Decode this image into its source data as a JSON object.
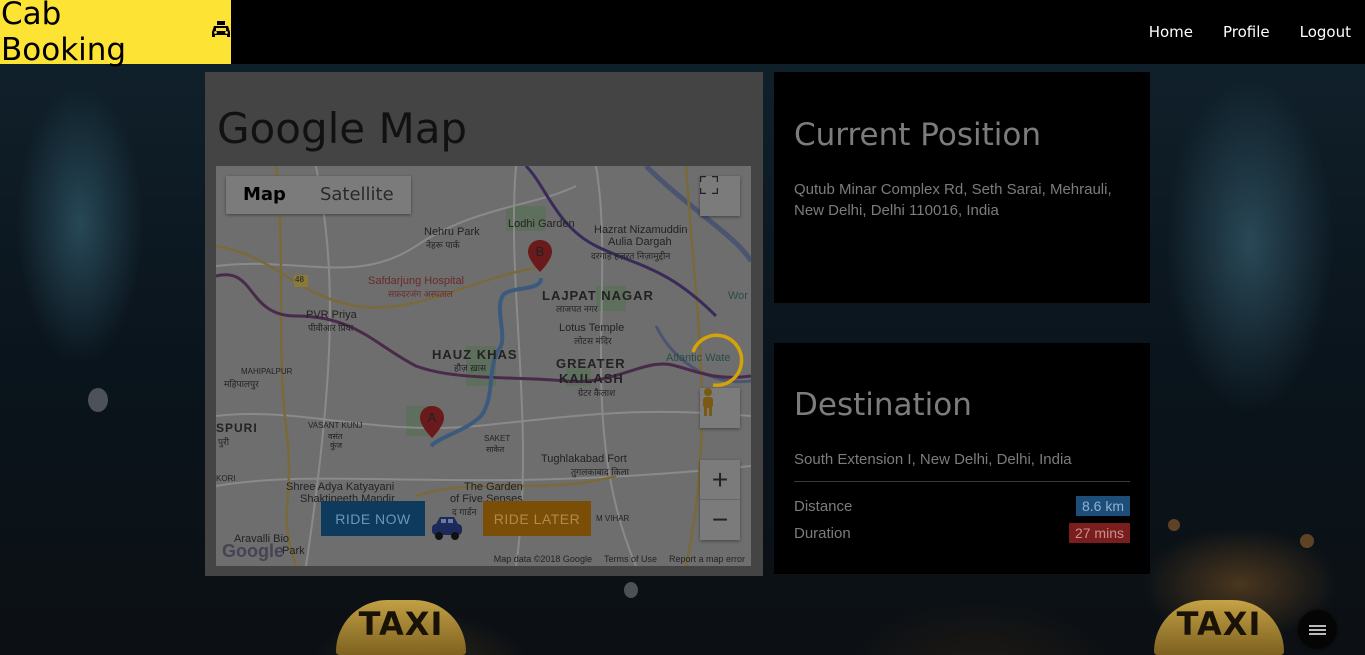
{
  "header": {
    "brand": "Cab Booking",
    "brand_icon": "taxi-icon",
    "nav": [
      "Home",
      "Profile",
      "Logout"
    ]
  },
  "map_panel": {
    "title": "Google Map",
    "map_type": {
      "map": "Map",
      "satellite": "Satellite"
    },
    "labels": {
      "lodhi_garden": "Lodhi Garden",
      "nehru_park": "Nehru Park",
      "nehru_park_hi": "नेहरू पार्क",
      "hazrat": "Hazrat Nizamuddin",
      "aulia": "Aulia Dargah",
      "aulia_hi": "दरगाह हज़रत निज़ामुद्दीन",
      "safdarjung": "Safdarjung Hospital",
      "safdarjung_hi": "सफ़दरजंग अस्पताल",
      "lajpat": "LAJPAT NAGAR",
      "lajpat_hi": "लाजपत नगर",
      "pvr": "PVR Priya",
      "pvr_hi": "पीवीआर प्रिया",
      "lotus": "Lotus Temple",
      "lotus_hi": "लोटस मंदिर",
      "hauz": "HAUZ KHAS",
      "hauz_hi": "हौज़ ख़ास",
      "greater": "GREATER",
      "kailash": "KAILASH",
      "gk_hi": "ग्रेटर कैलाश",
      "atlantic": "Atlantic Wate",
      "mahipalpur": "MAHIPALPUR",
      "mahipalpur_hi": "महिपालपुर",
      "spuri": "SPURI",
      "puri_hi": "पुरी",
      "vasant": "VASANT KUNJ",
      "vasant_hi1": "वसंत",
      "vasant_hi2": "कुंज",
      "saket": "SAKET",
      "saket_hi": "साकेत",
      "tughlakabad": "Tughlakabad Fort",
      "tughlakabad_hi": "तुगलकाबाद किला",
      "shree": "Shree Adya Katyayani",
      "shakti": "Shaktipeeth Mandir",
      "garden": "The Garden",
      "five": "of Five Senses",
      "garden_hi": "द गार्डन",
      "aravalli": "Aravalli Bio",
      "park": "Park",
      "mvihar": "M VIHAR",
      "wor": "Wor",
      "road_48": "48",
      "kori": "KORI"
    },
    "markers": {
      "a": "A",
      "b": "B"
    },
    "ride_now": "RIDE NOW",
    "ride_later": "RIDE LATER",
    "google_logo": "Google",
    "footer": [
      "Map data ©2018 Google",
      "Terms of Use",
      "Report a map error"
    ],
    "controls": {
      "zoom_in": "+",
      "zoom_out": "−"
    }
  },
  "current_position": {
    "title": "Current Position",
    "address": "Qutub Minar Complex Rd, Seth Sarai, Mehrauli, New Delhi, Delhi 110016, India"
  },
  "destination": {
    "title": "Destination",
    "address": "South Extension I, New Delhi, Delhi, India",
    "distance_label": "Distance",
    "distance_value": "8.6 km",
    "duration_label": "Duration",
    "duration_value": "27 mins"
  },
  "background": {
    "taxi_sign": "TAXI"
  },
  "colors": {
    "brand": "#fde334",
    "header": "#000000",
    "distance_badge": "#1d4e7a",
    "duration_badge": "#7a1d1d",
    "ride_now": "#0e3a5e",
    "ride_later": "#7a4e06"
  }
}
